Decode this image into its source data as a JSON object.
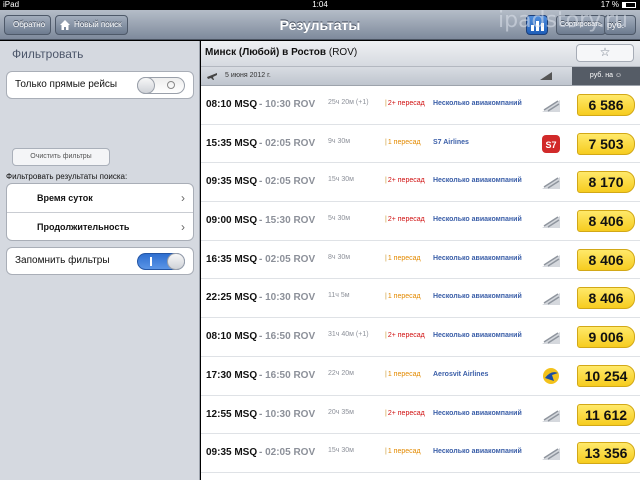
{
  "status_bar": {
    "device": "iPad",
    "time": "1:04",
    "battery": "17 %"
  },
  "nav": {
    "back_label": "Обратно",
    "home_label": "Новый поиск",
    "title": "Результаты",
    "sort_label": "Сортировать",
    "currency_label": "руб."
  },
  "sidebar": {
    "heading": "Фильтровать",
    "direct_label": "Только прямые рейсы",
    "direct_enabled": false,
    "clear_label": "Очистить фильтры",
    "filter_caption": "Фильтровать результаты поиска:",
    "time_label": "Время суток",
    "duration_label": "Продолжительность",
    "remember_label": "Запомнить фильтры",
    "remember_enabled": true
  },
  "route": {
    "text": "Минск (Любой) в Ростов",
    "code": "(ROV)",
    "star": "☆"
  },
  "date_bar": {
    "date": "5 июня 2012 г.",
    "price_header": "руб. на"
  },
  "flights": [
    {
      "dep": "08:10 MSQ",
      "arr": "- 10:30 ROV",
      "duration": "25ч 20м (+1)",
      "stops": "2+ пересад",
      "stops_color": "red",
      "airline": "Несколько авиакомпаний",
      "logo": "multi-icon",
      "price": "6 586"
    },
    {
      "dep": "15:35 MSQ",
      "arr": "- 02:05 ROV",
      "duration": "9ч 30м",
      "stops": "1 пересад",
      "stops_color": "orange",
      "airline": "S7 Airlines",
      "logo": "s7-logo-icon",
      "price": "7 503"
    },
    {
      "dep": "09:35 MSQ",
      "arr": "- 02:05 ROV",
      "duration": "15ч 30м",
      "stops": "2+ пересад",
      "stops_color": "red",
      "airline": "Несколько авиакомпаний",
      "logo": "multi-icon",
      "price": "8 170"
    },
    {
      "dep": "09:00 MSQ",
      "arr": "- 15:30 ROV",
      "duration": "5ч 30м",
      "stops": "2+ пересад",
      "stops_color": "red",
      "airline": "Несколько авиакомпаний",
      "logo": "multi-icon",
      "price": "8 406"
    },
    {
      "dep": "16:35 MSQ",
      "arr": "- 02:05 ROV",
      "duration": "8ч 30м",
      "stops": "1 пересад",
      "stops_color": "orange",
      "airline": "Несколько авиакомпаний",
      "logo": "multi-icon",
      "price": "8 406"
    },
    {
      "dep": "22:25 MSQ",
      "arr": "- 10:30 ROV",
      "duration": "11ч 5м",
      "stops": "1 пересад",
      "stops_color": "orange",
      "airline": "Несколько авиакомпаний",
      "logo": "multi-icon",
      "price": "8 406"
    },
    {
      "dep": "08:10 MSQ",
      "arr": "- 16:50 ROV",
      "duration": "31ч 40м (+1)",
      "stops": "2+ пересад",
      "stops_color": "red",
      "airline": "Несколько авиакомпаний",
      "logo": "multi-icon",
      "price": "9 006"
    },
    {
      "dep": "17:30 MSQ",
      "arr": "- 16:50 ROV",
      "duration": "22ч 20м",
      "stops": "1 пересад",
      "stops_color": "orange",
      "airline": "Aerosvit Airlines",
      "logo": "aerosvit-logo-icon",
      "price": "10 254"
    },
    {
      "dep": "12:55 MSQ",
      "arr": "- 10:30 ROV",
      "duration": "20ч 35м",
      "stops": "2+ пересад",
      "stops_color": "red",
      "airline": "Несколько авиакомпаний",
      "logo": "multi-icon",
      "price": "11 612"
    },
    {
      "dep": "09:35 MSQ",
      "arr": "- 02:05 ROV",
      "duration": "15ч 30м",
      "stops": "1 пересад",
      "stops_color": "orange",
      "airline": "Несколько авиакомпаний",
      "logo": "multi-icon",
      "price": "13 356"
    }
  ],
  "watermark": "ipadstory.ru"
}
